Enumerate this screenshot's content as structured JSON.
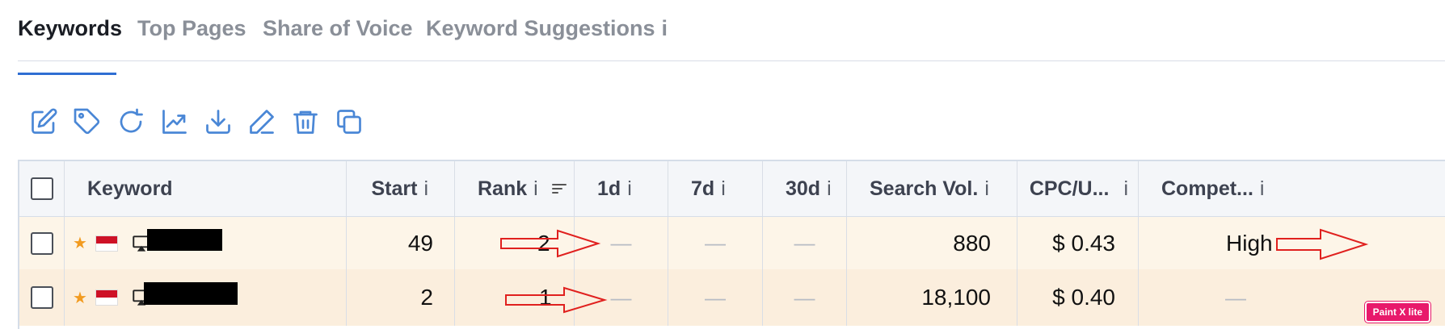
{
  "tabs": [
    {
      "label": "Keywords",
      "active": true
    },
    {
      "label": "Top Pages",
      "active": false
    },
    {
      "label": "Share of Voice",
      "active": false
    },
    {
      "label": "Keyword Suggestions",
      "info": "i",
      "active": false
    }
  ],
  "toolbar": {
    "icons": [
      "edit-icon",
      "tag-icon",
      "refresh-icon",
      "trend-chart-icon",
      "download-icon",
      "pencil-icon",
      "trash-icon",
      "copy-icon"
    ],
    "color": "#4a87d6"
  },
  "table": {
    "headers": {
      "keyword": "Keyword",
      "start": "Start",
      "rank": "Rank",
      "d1": "1d",
      "d7": "7d",
      "d30": "30d",
      "search_vol": "Search Vol.",
      "cpc": "CPC/U...",
      "competition": "Compet...",
      "info": "i"
    },
    "rows": [
      {
        "start": "49",
        "rank": "2",
        "d1": "—",
        "d7": "—",
        "d30": "—",
        "search_vol": "880",
        "cpc": "$ 0.43",
        "competition": "High"
      },
      {
        "start": "2",
        "rank": "1",
        "d1": "—",
        "d7": "—",
        "d30": "—",
        "search_vol": "18,100",
        "cpc": "$ 0.40",
        "competition": "—"
      }
    ]
  },
  "watermark": "Paint X lite",
  "colors": {
    "accent": "#2f6ed3",
    "row1_bg": "#fdf5e8",
    "row2_bg": "#fbeedd",
    "arrow": "#e0201e",
    "star": "#f29b20"
  }
}
